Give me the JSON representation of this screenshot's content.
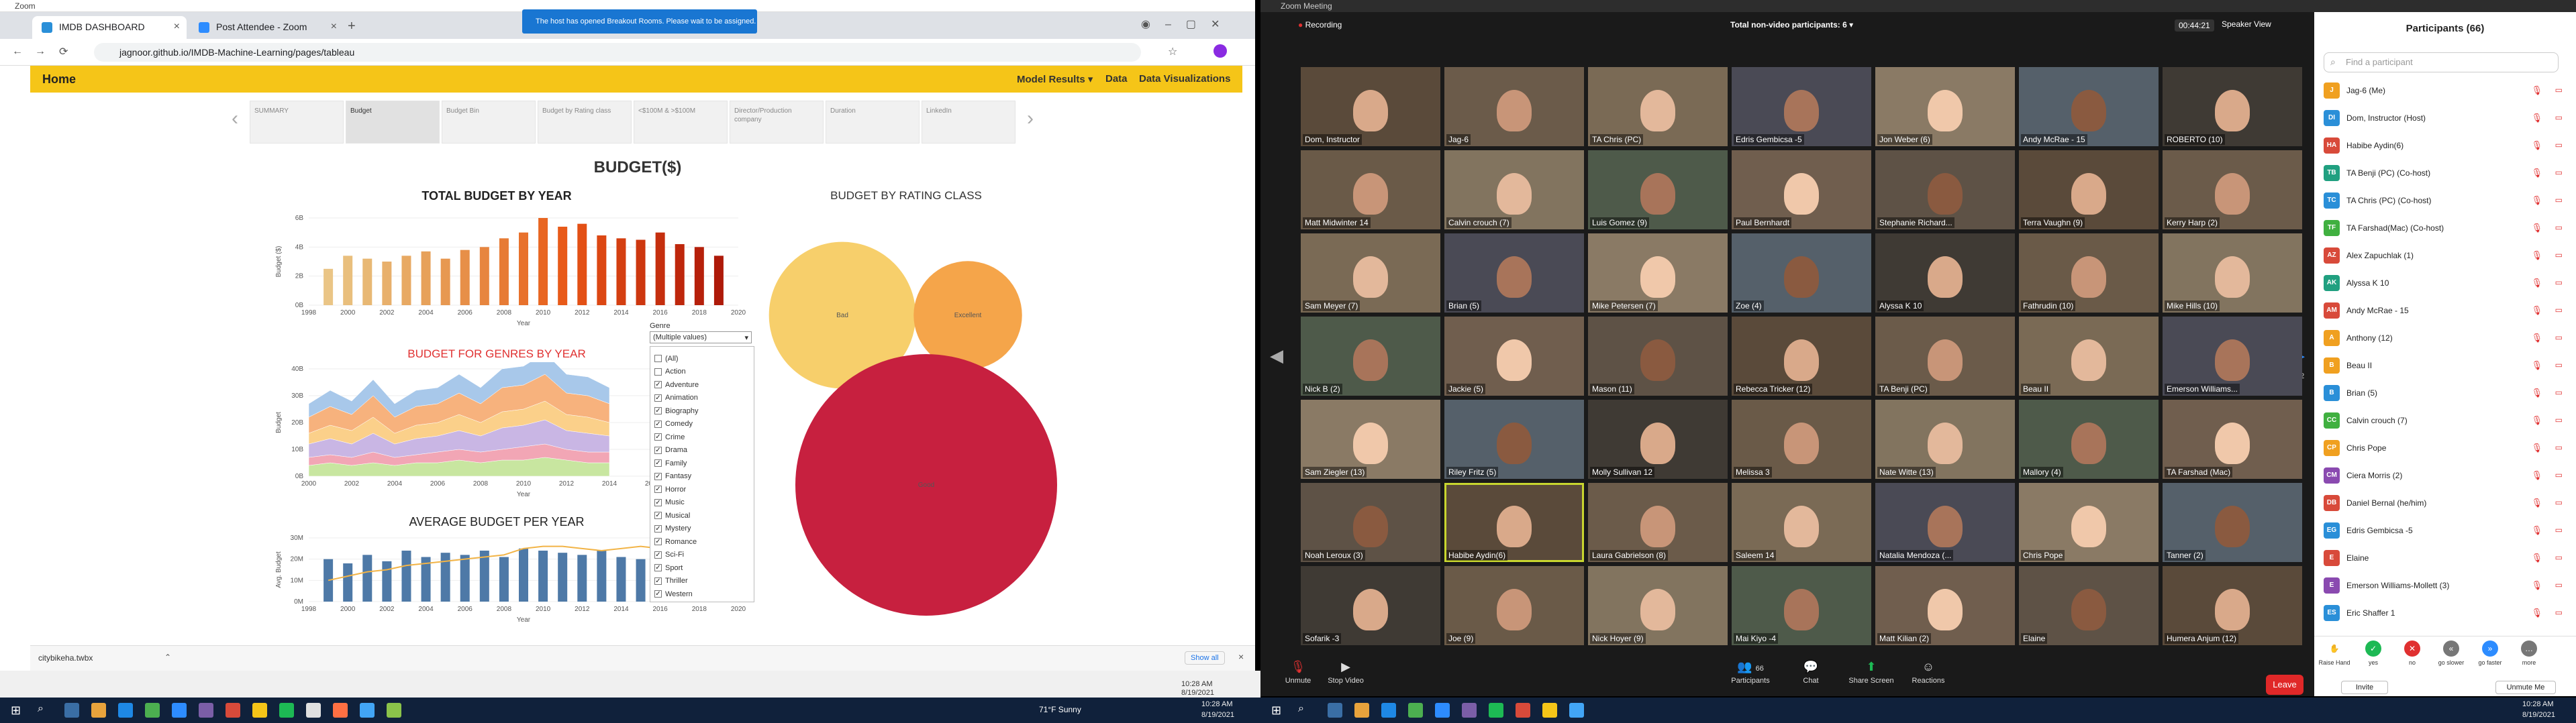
{
  "browser": {
    "zoom_strip_label": "Zoom",
    "tabs": [
      {
        "label": "IMDB DASHBOARD",
        "active": true
      },
      {
        "label": "Post Attendee - Zoom",
        "active": false
      }
    ],
    "url": "jagnoor.github.io/IMDB-Machine-Learning/pages/tableau",
    "notification": "The host has opened Breakout Rooms. Please wait to be assigned.",
    "nav": {
      "home": "Home",
      "model_results": "Model Results ▾",
      "data": "Data",
      "data_visualizations": "Data Visualizations"
    },
    "dash_tabs": [
      "SUMMARY",
      "Budget",
      "Budget Bin",
      "Budget by Rating class",
      "<$100M & >$100M",
      "Director/Production company",
      "Duration",
      "LinkedIn"
    ],
    "dashboard_title": "BUDGET($)",
    "download_file": "citybikeha.twbx",
    "show_all": "Show all",
    "time": "10:28 AM",
    "date": "8/19/2021"
  },
  "chart_data": [
    {
      "type": "bar",
      "title": "TOTAL BUDGET BY YEAR",
      "xlabel": "Year",
      "ylabel": "Budget ($)",
      "x": [
        1999,
        2000,
        2001,
        2002,
        2003,
        2004,
        2005,
        2006,
        2007,
        2008,
        2009,
        2010,
        2011,
        2012,
        2013,
        2014,
        2015,
        2016,
        2017,
        2018,
        2019
      ],
      "values": [
        2.5,
        3.4,
        3.2,
        3.0,
        3.4,
        3.7,
        3.2,
        3.8,
        4.0,
        4.6,
        5.0,
        6.0,
        5.4,
        5.6,
        4.8,
        4.6,
        4.5,
        5.0,
        4.2,
        4.0,
        3.4
      ],
      "ylim": [
        0,
        6
      ],
      "yticks": [
        "0B",
        "2B",
        "4B",
        "6B"
      ],
      "xticks": [
        "1998",
        "2000",
        "2002",
        "2004",
        "2006",
        "2008",
        "2010",
        "2012",
        "2014",
        "2016",
        "2018",
        "2020"
      ]
    },
    {
      "type": "area",
      "title": "BUDGET FOR GENRES BY YEAR",
      "xlabel": "Year",
      "ylabel": "Budget",
      "x": [
        2000,
        2001,
        2002,
        2003,
        2004,
        2005,
        2006,
        2007,
        2008,
        2009,
        2010,
        2011,
        2012,
        2013,
        2014
      ],
      "series": [
        {
          "values": [
            4,
            5,
            4,
            5,
            4,
            5,
            5,
            6,
            5,
            6,
            6,
            7,
            6,
            5,
            5
          ]
        },
        {
          "values": [
            3,
            3,
            3,
            4,
            3,
            3,
            4,
            4,
            4,
            4,
            5,
            5,
            4,
            4,
            4
          ]
        },
        {
          "values": [
            5,
            6,
            5,
            7,
            5,
            6,
            6,
            7,
            6,
            8,
            8,
            9,
            7,
            7,
            6
          ]
        },
        {
          "values": [
            4,
            5,
            5,
            6,
            4,
            5,
            5,
            6,
            5,
            6,
            6,
            7,
            6,
            6,
            5
          ]
        },
        {
          "values": [
            6,
            7,
            6,
            8,
            6,
            7,
            7,
            8,
            7,
            9,
            9,
            10,
            8,
            8,
            7
          ]
        },
        {
          "values": [
            5,
            6,
            5,
            6,
            5,
            6,
            6,
            7,
            6,
            7,
            7,
            8,
            7,
            7,
            6
          ]
        }
      ],
      "ylim": [
        0,
        40
      ],
      "yticks": [
        "0B",
        "10B",
        "20B",
        "30B",
        "40B"
      ],
      "xticks": [
        "2000",
        "2002",
        "2004",
        "2006",
        "2008",
        "2010",
        "2012",
        "2014",
        "2016",
        "2018",
        "2020"
      ]
    },
    {
      "type": "bar",
      "title": "AVERAGE BUDGET PER YEAR",
      "xlabel": "Year",
      "ylabel": "Avg. Budget",
      "x": [
        1999,
        2000,
        2001,
        2002,
        2003,
        2004,
        2005,
        2006,
        2007,
        2008,
        2009,
        2010,
        2011,
        2012,
        2013,
        2014,
        2015,
        2016,
        2017,
        2018
      ],
      "values": [
        20,
        18,
        22,
        19,
        24,
        21,
        23,
        22,
        24,
        21,
        25,
        24,
        23,
        22,
        24,
        21,
        20,
        24,
        26,
        24
      ],
      "line": [
        10,
        12,
        14,
        15,
        17,
        18,
        19,
        20,
        21,
        22,
        25,
        26,
        26,
        25,
        24,
        25,
        26,
        25,
        24,
        25
      ],
      "ylim": [
        0,
        30
      ],
      "yticks": [
        "0M",
        "10M",
        "20M",
        "30M"
      ],
      "xticks": [
        "1998",
        "2000",
        "2002",
        "2004",
        "2006",
        "2008",
        "2010",
        "2012",
        "2014",
        "2016",
        "2018",
        "2020"
      ],
      "right_axis_label": "Count of Imdb Ti.."
    },
    {
      "type": "scatter",
      "title": "BUDGET BY RATING CLASS",
      "categories": [
        "Bad",
        "Excellent",
        "Good"
      ],
      "values": [
        22,
        12,
        70
      ]
    }
  ],
  "genre_filter": {
    "label": "Genre",
    "selected": "(Multiple values)",
    "items": [
      {
        "label": "(All)",
        "checked": false
      },
      {
        "label": "Action",
        "checked": false
      },
      {
        "label": "Adventure",
        "checked": true
      },
      {
        "label": "Animation",
        "checked": true
      },
      {
        "label": "Biography",
        "checked": true
      },
      {
        "label": "Comedy",
        "checked": true
      },
      {
        "label": "Crime",
        "checked": true
      },
      {
        "label": "Drama",
        "checked": true
      },
      {
        "label": "Family",
        "checked": true
      },
      {
        "label": "Fantasy",
        "checked": true
      },
      {
        "label": "Horror",
        "checked": true
      },
      {
        "label": "Music",
        "checked": true
      },
      {
        "label": "Musical",
        "checked": true
      },
      {
        "label": "Mystery",
        "checked": true
      },
      {
        "label": "Romance",
        "checked": true
      },
      {
        "label": "Sci-Fi",
        "checked": true
      },
      {
        "label": "Sport",
        "checked": true
      },
      {
        "label": "Thriller",
        "checked": true
      },
      {
        "label": "Western",
        "checked": true
      }
    ]
  },
  "zoom": {
    "window_title": "Zoom Meeting",
    "recording": "Recording",
    "non_video": "Total non-video participants: 6 ▾",
    "timer": "00:44:21",
    "view": "Speaker View",
    "page": "1/2",
    "tiles": [
      "Dom, Instructor",
      "Jag-6",
      "TA Chris (PC)",
      "Edris Gembicsa -5",
      "Jon Weber (6)",
      "Andy McRae - 15",
      "ROBERTO (10)",
      "Matt Midwinter 14",
      "Calvin crouch (7)",
      "Luis Gomez (9)",
      "Paul Bernhardt",
      "Stephanie Richard...",
      "Terra Vaughn (9)",
      "Kerry Harp (2)",
      "Sam Meyer (7)",
      "Brian (5)",
      "Mike Petersen (7)",
      "Zoe (4)",
      "Alyssa K 10",
      "Fathrudin (10)",
      "Mike Hills (10)",
      "Nick B (2)",
      "Jackie (5)",
      "Mason (11)",
      "Rebecca Tricker (12)",
      "TA Benji (PC)",
      "Beau II",
      "Emerson Williams...",
      "Sam Ziegler (13)",
      "Riley Fritz (5)",
      "Molly Sullivan 12",
      "Melissa 3",
      "Nate Witte (13)",
      "Mallory (4)",
      "TA Farshad (Mac)",
      "Noah Leroux (3)",
      "Habibe Aydin(6)",
      "Laura Gabrielson (8)",
      "Saleem 14",
      "Natalia Mendoza (...",
      "Chris Pope",
      "Tanner (2)",
      "Sofarik -3",
      "Joe (9)",
      "Nick Hoyer (9)",
      "Mai Kiyo -4",
      "Matt Kilian (2)",
      "Elaine",
      "Humera Anjum (12)"
    ],
    "controls": [
      "Unmute",
      "Stop Video",
      "Participants",
      "Chat",
      "Share Screen",
      "Reactions"
    ],
    "participant_count": "66",
    "leave": "Leave"
  },
  "participants": {
    "title": "Participants (66)",
    "search_placeholder": "Find a participant",
    "list": [
      {
        "initials": "J",
        "name": "Jag-6 (Me)",
        "color": "#f0a020"
      },
      {
        "initials": "DI",
        "name": "Dom, Instructor (Host)",
        "color": "#2a8fd8"
      },
      {
        "initials": "HA",
        "name": "Habibe Aydin(6)",
        "color": "#d84a3a"
      },
      {
        "initials": "TB",
        "name": "TA Benji (PC) (Co-host)",
        "color": "#20a080"
      },
      {
        "initials": "TC",
        "name": "TA Chris (PC) (Co-host)",
        "color": "#2a8fd8"
      },
      {
        "initials": "TF",
        "name": "TA Farshad(Mac) (Co-host)",
        "color": "#40b040"
      },
      {
        "initials": "AZ",
        "name": "Alex Zapuchlak (1)",
        "color": "#d84a3a"
      },
      {
        "initials": "AK",
        "name": "Alyssa K 10",
        "color": "#20a080"
      },
      {
        "initials": "AM",
        "name": "Andy McRae - 15",
        "color": "#d84a3a"
      },
      {
        "initials": "A",
        "name": "Anthony (12)",
        "color": "#f0a020"
      },
      {
        "initials": "B",
        "name": "Beau II",
        "color": "#f0a020"
      },
      {
        "initials": "B",
        "name": "Brian (5)",
        "color": "#2a8fd8"
      },
      {
        "initials": "CC",
        "name": "Calvin crouch (7)",
        "color": "#40b040"
      },
      {
        "initials": "CP",
        "name": "Chris Pope",
        "color": "#f0a020"
      },
      {
        "initials": "CM",
        "name": "Ciera Morris (2)",
        "color": "#8a4ab0"
      },
      {
        "initials": "DB",
        "name": "Daniel Bernal (he/him)",
        "color": "#d84a3a"
      },
      {
        "initials": "EG",
        "name": "Edris Gembicsa -5",
        "color": "#2a8fd8"
      },
      {
        "initials": "E",
        "name": "Elaine",
        "color": "#d84a3a"
      },
      {
        "initials": "E",
        "name": "Emerson Williams-Mollett (3)",
        "color": "#8a4ab0"
      },
      {
        "initials": "ES",
        "name": "Eric Shaffer 1",
        "color": "#2a8fd8"
      }
    ],
    "reactions": [
      "Raise Hand",
      "yes",
      "no",
      "go slower",
      "go faster",
      "more"
    ],
    "invite": "Invite",
    "mute_me": "Unmute Me"
  },
  "taskbar": {
    "weather": "71°F  Sunny",
    "time": "10:28 AM",
    "date": "8/19/2021"
  }
}
